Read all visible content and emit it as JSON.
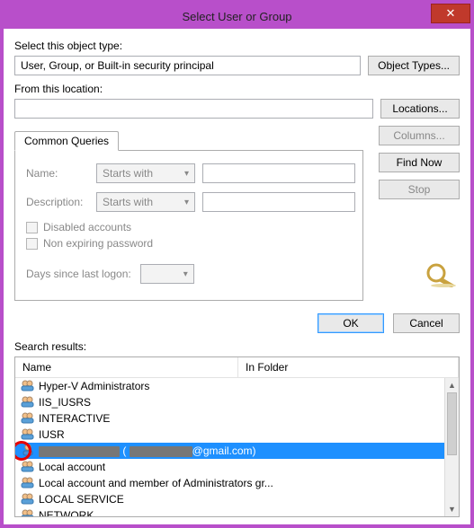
{
  "title": "Select User or Group",
  "labels": {
    "selectObjectType": "Select this object type:",
    "fromLocation": "From this location:",
    "tabCommonQueries": "Common Queries",
    "name": "Name:",
    "description": "Description:",
    "startsWith": "Starts with",
    "disabledAccounts": "Disabled accounts",
    "nonExpiring": "Non expiring password",
    "daysSinceLogon": "Days since last logon:",
    "searchResults": "Search results:",
    "colName": "Name",
    "colFolder": "In Folder"
  },
  "values": {
    "objectType": "User, Group, or Built-in security principal",
    "location": "",
    "nameFilter": "",
    "descFilter": ""
  },
  "buttons": {
    "objectTypes": "Object Types...",
    "locations": "Locations...",
    "columns": "Columns...",
    "findNow": "Find Now",
    "stop": "Stop",
    "ok": "OK",
    "cancel": "Cancel",
    "close": "✕"
  },
  "results": [
    {
      "name": "Hyper-V Administrators",
      "icon": "group"
    },
    {
      "name": "IIS_IUSRS",
      "icon": "group"
    },
    {
      "name": "INTERACTIVE",
      "icon": "group"
    },
    {
      "name": "IUSR",
      "icon": "group"
    },
    {
      "name_prefix_masked": true,
      "name_suffix": "@gmail.com)",
      "icon": "user",
      "selected": true
    },
    {
      "name": "Local account",
      "icon": "group"
    },
    {
      "name": "Local account and member of Administrators gr...",
      "icon": "group"
    },
    {
      "name": "LOCAL SERVICE",
      "icon": "group"
    },
    {
      "name": "NETWORK",
      "icon": "group"
    }
  ]
}
